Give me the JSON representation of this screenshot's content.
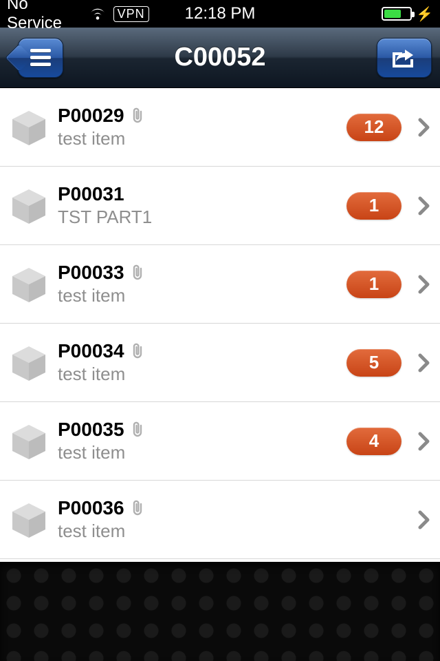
{
  "status": {
    "carrier": "No Service",
    "vpn": "VPN",
    "time": "12:18 PM"
  },
  "nav": {
    "title": "C00052"
  },
  "items": [
    {
      "code": "P00029",
      "desc": "test item",
      "badge": "12",
      "has_attachment": true,
      "has_badge": true
    },
    {
      "code": "P00031",
      "desc": "TST PART1",
      "badge": "1",
      "has_attachment": false,
      "has_badge": true
    },
    {
      "code": "P00033",
      "desc": "test item",
      "badge": "1",
      "has_attachment": true,
      "has_badge": true
    },
    {
      "code": "P00034",
      "desc": "test item",
      "badge": "5",
      "has_attachment": true,
      "has_badge": true
    },
    {
      "code": "P00035",
      "desc": "test item",
      "badge": "4",
      "has_attachment": true,
      "has_badge": true
    },
    {
      "code": "P00036",
      "desc": "test item",
      "badge": "",
      "has_attachment": true,
      "has_badge": false
    }
  ]
}
